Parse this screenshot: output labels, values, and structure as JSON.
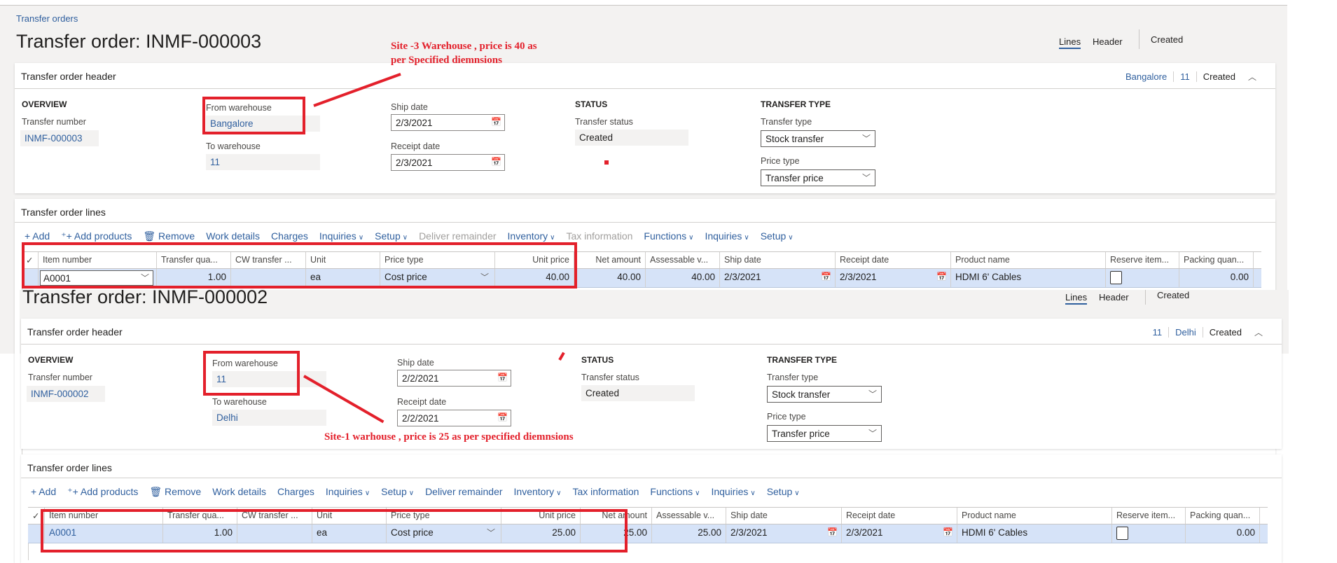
{
  "orders": [
    {
      "breadcrumb": "Transfer orders",
      "title": "Transfer order: INMF-000003",
      "tabs": {
        "lines": "Lines",
        "header": "Header",
        "status": "Created"
      },
      "header_card": {
        "title": "Transfer order header",
        "summary": [
          {
            "text": "Bangalore",
            "link": true
          },
          {
            "text": "11",
            "link": true
          },
          {
            "text": "Created",
            "link": false
          }
        ],
        "overview": "OVERVIEW",
        "transfer_number_label": "Transfer number",
        "transfer_number": "INMF-000003",
        "from_label": "From warehouse",
        "from": "Bangalore",
        "to_label": "To warehouse",
        "to": "11",
        "ship_label": "Ship date",
        "ship": "2/3/2021",
        "receipt_label": "Receipt date",
        "receipt": "2/3/2021",
        "status_section": "STATUS",
        "status_label": "Transfer status",
        "status": "Created",
        "type_section": "TRANSFER TYPE",
        "type_label": "Transfer type",
        "type": "Stock transfer",
        "price_type_label": "Price type",
        "price_type": "Transfer price"
      },
      "lines_card": {
        "title": "Transfer order lines",
        "item_editing": true,
        "toolbar": [
          {
            "label": "+ Add",
            "disabled": false
          },
          {
            "label": "⁺+ Add products",
            "disabled": false
          },
          {
            "label": "🗑 Remove",
            "disabled": false
          },
          {
            "label": "Work details",
            "disabled": false
          },
          {
            "label": "Charges",
            "disabled": false
          },
          {
            "label": "Inquiries",
            "disabled": false,
            "menu": true
          },
          {
            "label": "Setup",
            "disabled": false,
            "menu": true
          },
          {
            "label": "Deliver remainder",
            "disabled": true
          },
          {
            "label": "Inventory",
            "disabled": false,
            "menu": true
          },
          {
            "label": "Tax information",
            "disabled": true
          },
          {
            "label": "Functions",
            "disabled": false,
            "menu": true
          },
          {
            "label": "Inquiries",
            "disabled": false,
            "menu": true
          },
          {
            "label": "Setup",
            "disabled": false,
            "menu": true
          }
        ],
        "columns": [
          "✓",
          "Item number",
          "Transfer qua...",
          "CW transfer ...",
          "Unit",
          "Price type",
          "Unit price",
          "Net amount",
          "Assessable v...",
          "Ship date",
          "Receipt date",
          "Product name",
          "Reserve item...",
          "Packing quan..."
        ],
        "row": {
          "item": "A0001",
          "qty": "1.00",
          "cw": "",
          "unit": "ea",
          "price_type": "Cost price",
          "unit_price": "40.00",
          "net": "40.00",
          "assessable": "40.00",
          "ship": "2/3/2021",
          "receipt": "2/3/2021",
          "product": "HDMI 6' Cables",
          "reserve": false,
          "packing": "0.00"
        }
      }
    },
    {
      "breadcrumb": "Transfer orders",
      "title": "Transfer order: INMF-000002",
      "tabs": {
        "lines": "Lines",
        "header": "Header",
        "status": "Created"
      },
      "header_card": {
        "title": "Transfer order header",
        "summary": [
          {
            "text": "11",
            "link": true
          },
          {
            "text": "Delhi",
            "link": true
          },
          {
            "text": "Created",
            "link": false
          }
        ],
        "overview": "OVERVIEW",
        "transfer_number_label": "Transfer number",
        "transfer_number": "INMF-000002",
        "from_label": "From warehouse",
        "from": "11",
        "to_label": "To warehouse",
        "to": "Delhi",
        "ship_label": "Ship date",
        "ship": "2/2/2021",
        "receipt_label": "Receipt date",
        "receipt": "2/2/2021",
        "status_section": "STATUS",
        "status_label": "Transfer status",
        "status": "Created",
        "type_section": "TRANSFER TYPE",
        "type_label": "Transfer type",
        "type": "Stock transfer",
        "price_type_label": "Price type",
        "price_type": "Transfer price"
      },
      "lines_card": {
        "title": "Transfer order lines",
        "item_editing": false,
        "toolbar": [
          {
            "label": "+ Add",
            "disabled": false
          },
          {
            "label": "⁺+ Add products",
            "disabled": false
          },
          {
            "label": "🗑 Remove",
            "disabled": false
          },
          {
            "label": "Work details",
            "disabled": false
          },
          {
            "label": "Charges",
            "disabled": false
          },
          {
            "label": "Inquiries",
            "disabled": false,
            "menu": true
          },
          {
            "label": "Setup",
            "disabled": false,
            "menu": true
          },
          {
            "label": "Deliver remainder",
            "disabled": false
          },
          {
            "label": "Inventory",
            "disabled": false,
            "menu": true
          },
          {
            "label": "Tax information",
            "disabled": false
          },
          {
            "label": "Functions",
            "disabled": false,
            "menu": true
          },
          {
            "label": "Inquiries",
            "disabled": false,
            "menu": true
          },
          {
            "label": "Setup",
            "disabled": false,
            "menu": true
          }
        ],
        "columns": [
          "✓",
          "Item number",
          "Transfer qua...",
          "CW transfer ...",
          "Unit",
          "Price type",
          "Unit price",
          "Net amount",
          "Assessable v...",
          "Ship date",
          "Receipt date",
          "Product name",
          "Reserve item...",
          "Packing quan..."
        ],
        "row": {
          "item": "A0001",
          "qty": "1.00",
          "cw": "",
          "unit": "ea",
          "price_type": "Cost price",
          "unit_price": "25.00",
          "net": "25.00",
          "assessable": "25.00",
          "ship": "2/3/2021",
          "receipt": "2/3/2021",
          "product": "HDMI 6' Cables",
          "reserve": false,
          "packing": "0.00"
        }
      }
    }
  ],
  "annotations": {
    "note1_line1": "Site -3 Warehouse , price is 40 as",
    "note1_line2": "per Specified diemnsions",
    "note2": "Site-1 warhouse , price is 25 as per specified diemnsions",
    "color": "#e3202b"
  }
}
